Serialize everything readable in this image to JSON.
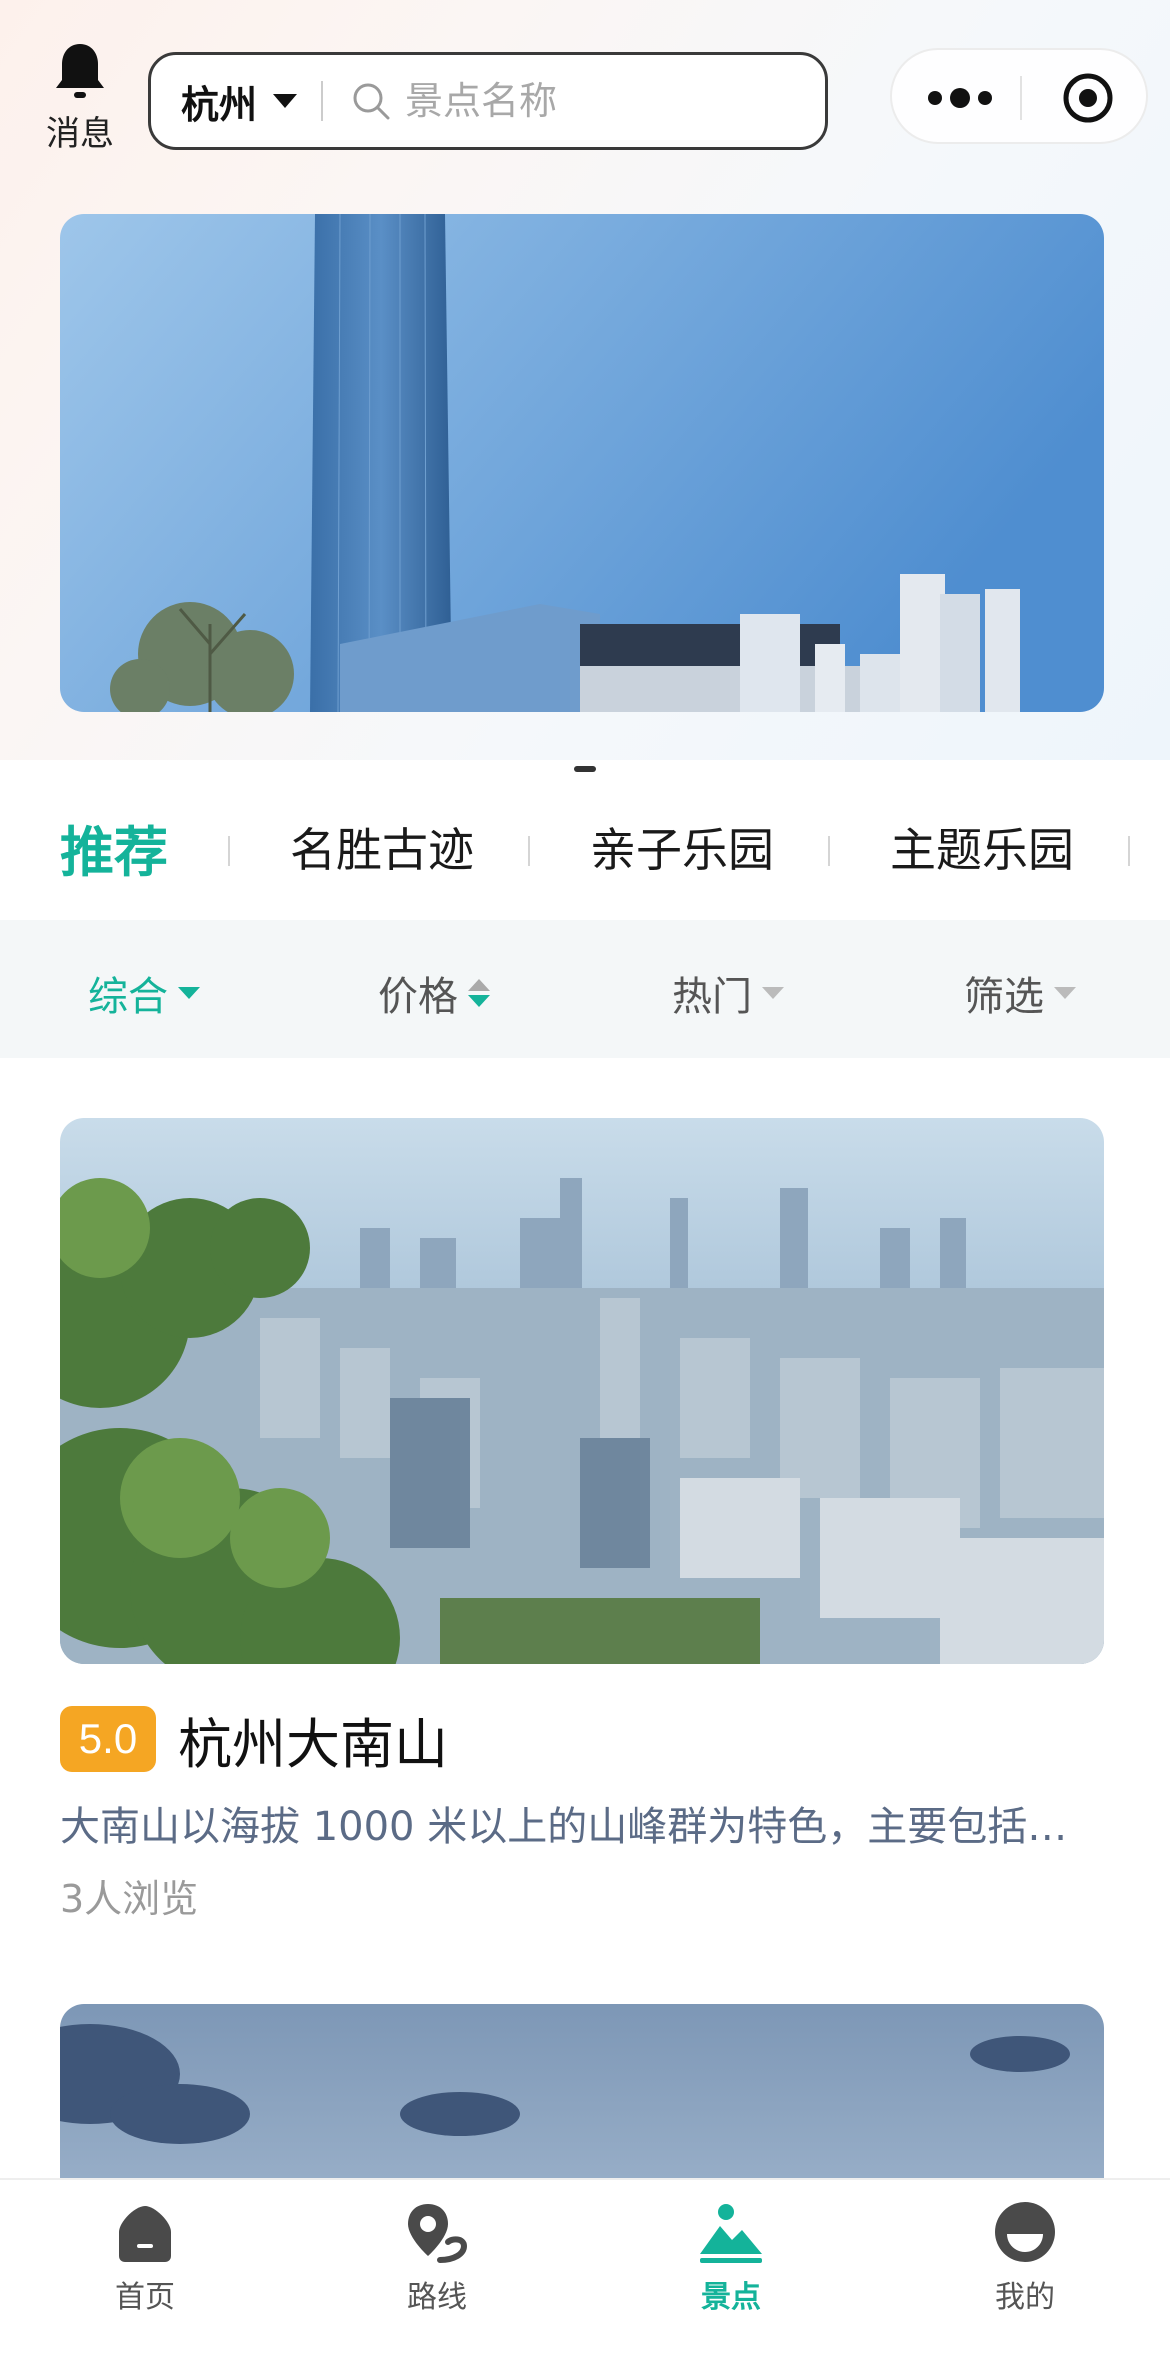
{
  "header": {
    "message_label": "消息",
    "city": "杭州",
    "search_placeholder": "景点名称"
  },
  "categories": [
    "推荐",
    "名胜古迹",
    "亲子乐园",
    "主题乐园"
  ],
  "filters": [
    "综合",
    "价格",
    "热门",
    "筛选"
  ],
  "card": {
    "rating": "5.0",
    "title": "杭州大南山",
    "description": "大南山以海拔 1000 米以上的山峰群为特色，主要包括…",
    "views": "3人浏览"
  },
  "tabbar": {
    "items": [
      "首页",
      "路线",
      "景点",
      "我的"
    ],
    "active": "景点"
  },
  "colors": {
    "accent": "#14b39a",
    "rating_badge": "#f5a623",
    "description_text": "#5b6b86"
  },
  "icons": [
    "bell-icon",
    "caret-down-icon",
    "search-icon",
    "more-icon",
    "target-icon",
    "home-icon",
    "route-icon",
    "scenery-icon",
    "profile-icon"
  ]
}
